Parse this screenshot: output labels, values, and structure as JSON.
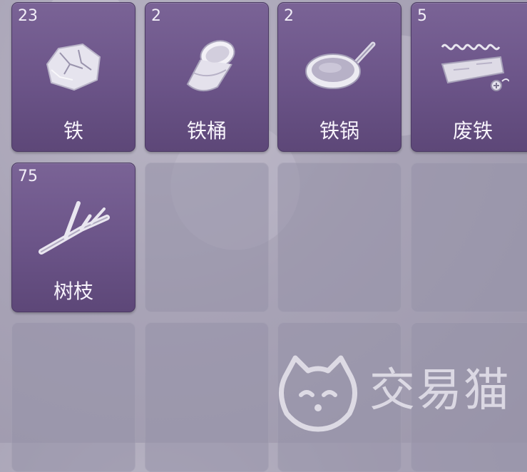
{
  "inventory": {
    "slots": [
      {
        "name": "铁",
        "count": "23",
        "icon": "iron-ore-icon"
      },
      {
        "name": "铁桶",
        "count": "2",
        "icon": "iron-bucket-icon"
      },
      {
        "name": "铁锅",
        "count": "2",
        "icon": "iron-pan-icon"
      },
      {
        "name": "废铁",
        "count": "5",
        "icon": "scrap-iron-icon"
      },
      {
        "name": "树枝",
        "count": "75",
        "icon": "branch-icon"
      }
    ]
  },
  "watermark": {
    "text": "交易猫",
    "icon": "cat-logo-icon"
  }
}
